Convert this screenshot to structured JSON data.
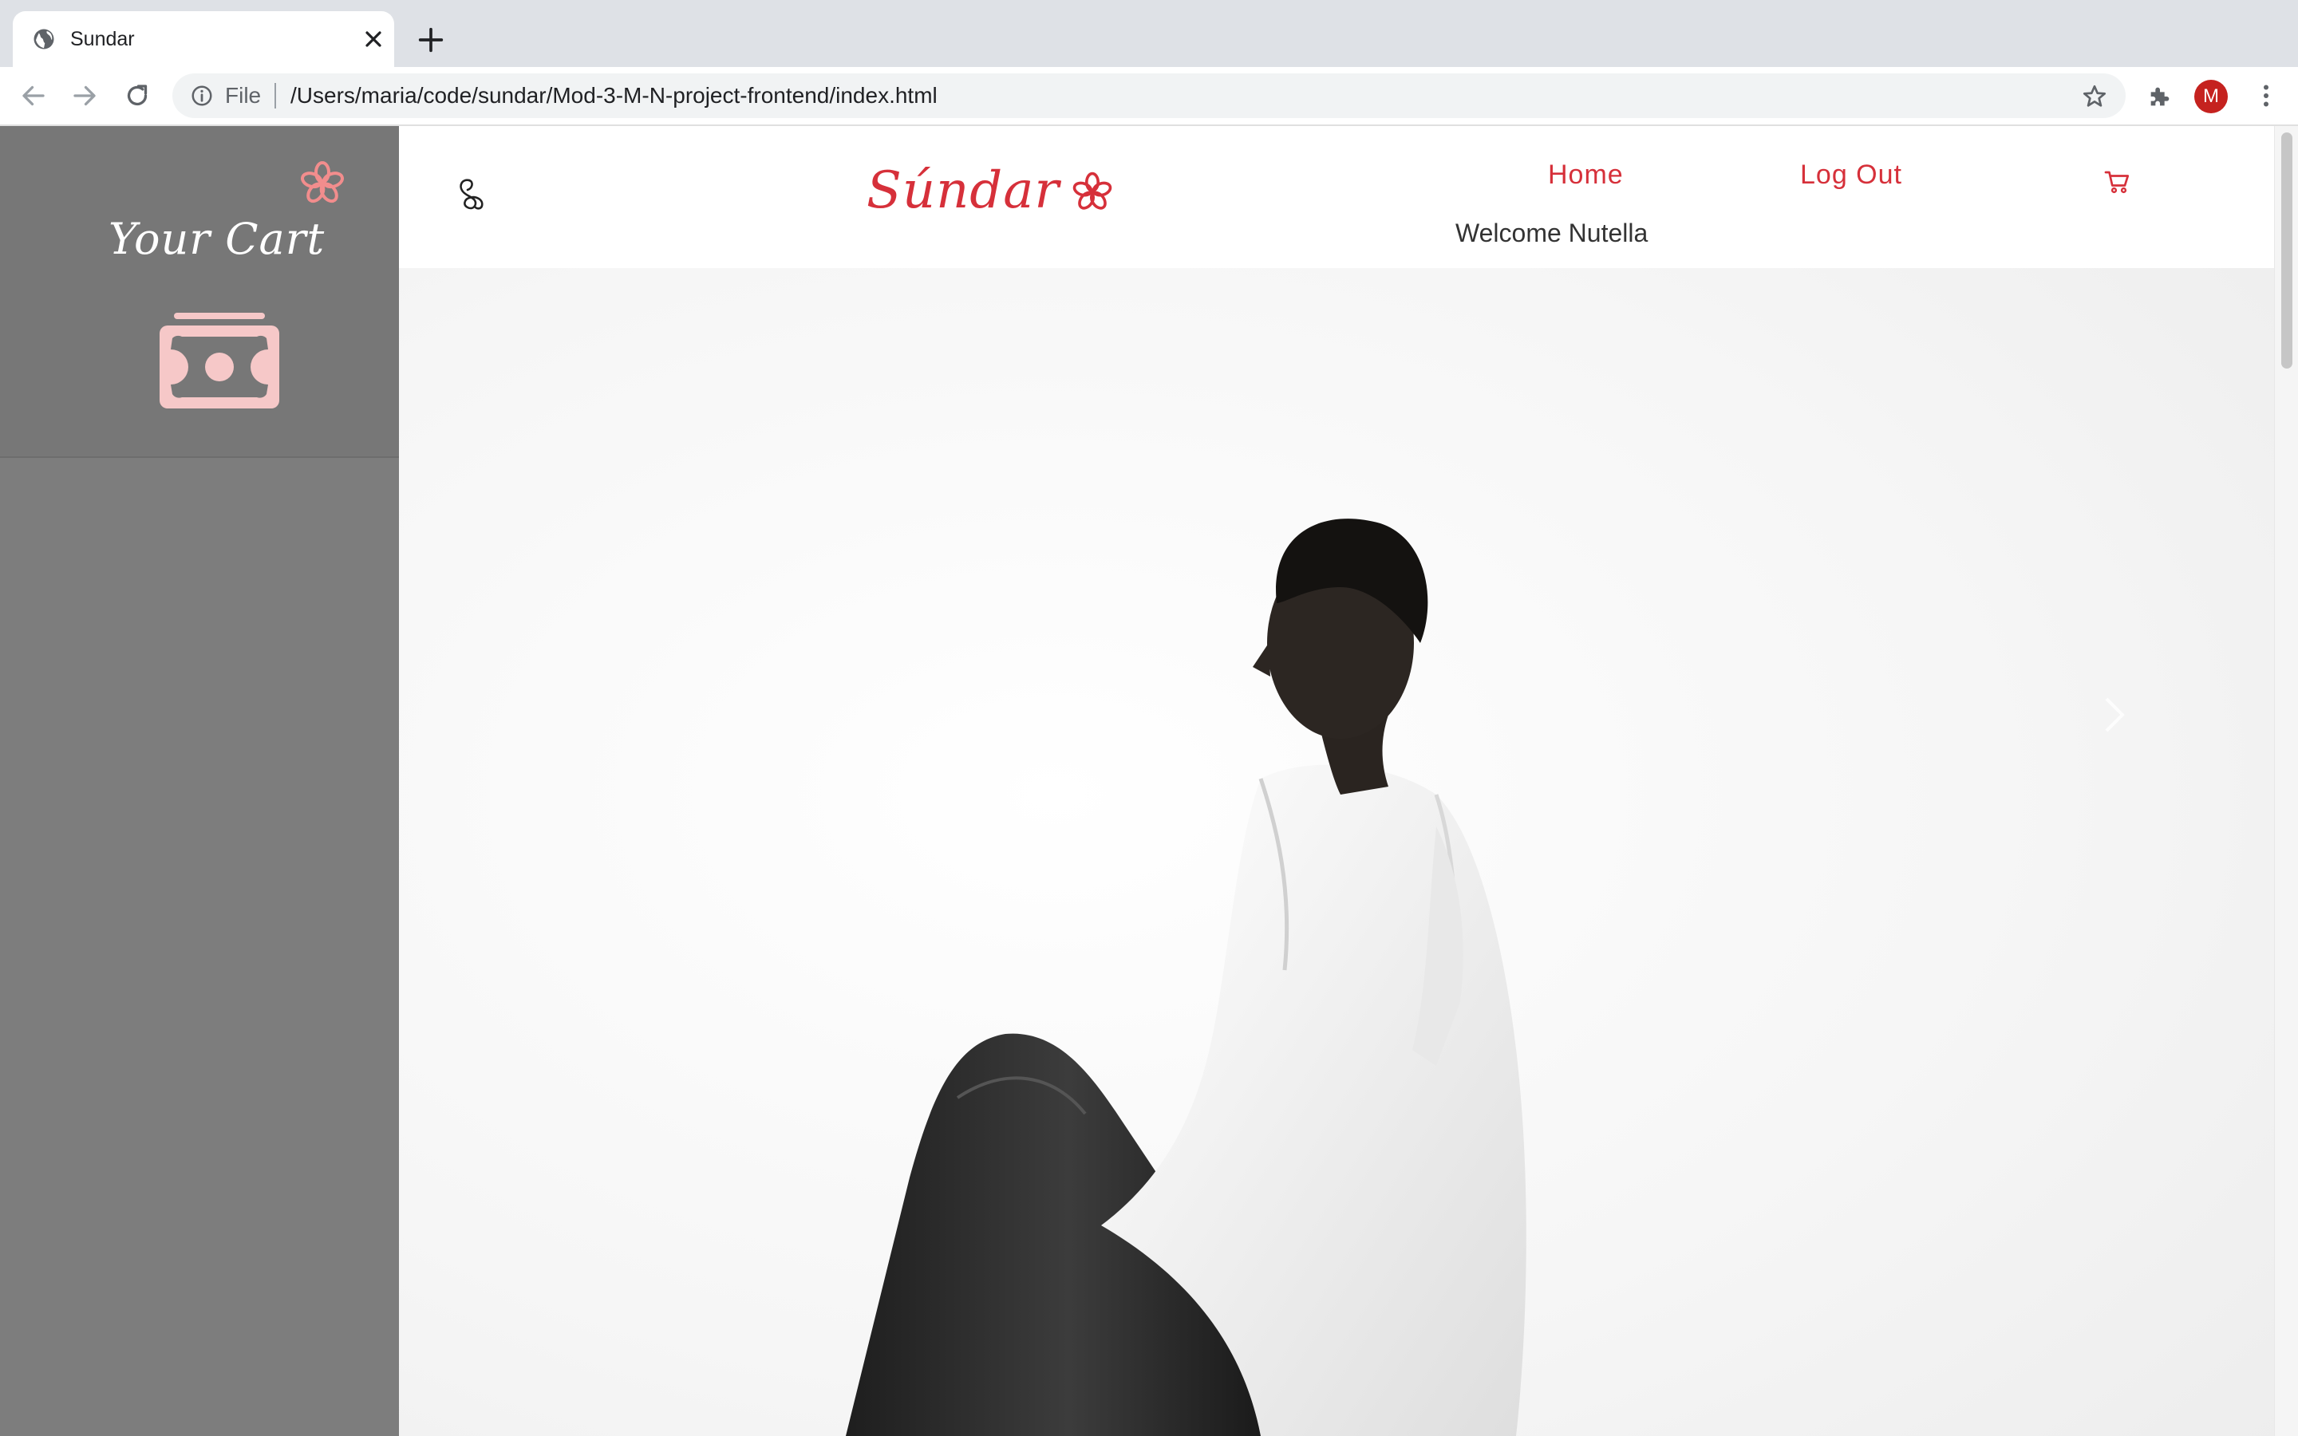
{
  "browser": {
    "tab_title": "Sundar",
    "url_scheme": "File",
    "url": "/Users/maria/code/sundar/Mod-3-M-N-project-frontend/index.html",
    "profile_initial": "M"
  },
  "sidebar": {
    "title": "Your Cart"
  },
  "header": {
    "logo_text": "Súndar",
    "nav": {
      "home": "Home",
      "logout": "Log Out"
    },
    "welcome": "Welcome Nutella"
  },
  "colors": {
    "accent": "#d6303a",
    "sidebar_bg": "#7d7d7d",
    "sidebar_icon_pink": "#f6c8c8",
    "sidebar_flower": "#f28d8d"
  },
  "icons": [
    "globe-favicon",
    "close-icon",
    "plus-icon",
    "back-arrow-icon",
    "forward-arrow-icon",
    "reload-icon",
    "info-icon",
    "star-icon",
    "puzzle-icon",
    "kebab-menu-icon",
    "flower-icon",
    "money-icon",
    "knot-icon",
    "cart-icon",
    "chevron-right-icon"
  ],
  "hero": {
    "image": "black-and-white fashion photo"
  }
}
